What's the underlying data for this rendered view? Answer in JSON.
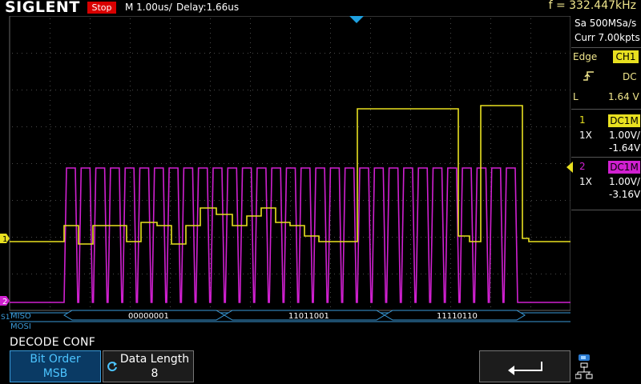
{
  "header": {
    "logo": "SIGLENT",
    "run_status": "Stop",
    "timebase": "M 1.00us/",
    "delay": "Delay:1.66us",
    "frequency": "f = 332.447kHz"
  },
  "acquisition": {
    "sample_rate": "Sa 500MSa/s",
    "memory": "Curr 7.00kpts"
  },
  "trigger": {
    "mode": "Edge",
    "source": "CH1",
    "coupling": "DC",
    "slope_icon": "rising-edge-icon",
    "level_label": "L",
    "level": "1.64 V"
  },
  "channels": [
    {
      "number": "1",
      "coupling": "DC1M",
      "probe": "1X",
      "scale": "1.00V/",
      "offset": "-1.64V",
      "color": "#e8e020"
    },
    {
      "number": "2",
      "coupling": "DC1M",
      "probe": "1X",
      "scale": "1.00V/",
      "offset": "-3.16V",
      "color": "#d020d0"
    }
  ],
  "trace_markers": {
    "ch1": "1",
    "ch2": "2"
  },
  "decode": {
    "bus_label": "S1",
    "lines": [
      "MISO",
      "MOSI"
    ],
    "frames": [
      "00000001",
      "11011001",
      "11110110"
    ],
    "color": "#3a9ad8"
  },
  "menu": {
    "title": "DECODE CONF",
    "bit_order_label": "Bit Order",
    "bit_order_value": "MSB",
    "data_length_label": "Data Length",
    "data_length_value": "8",
    "back_icon": "back-arrow-icon"
  },
  "colors": {
    "ch1": "#e8e020",
    "ch2": "#d020d0",
    "trigger_marker": "#1ea0e0",
    "grid": "#4a4a4a"
  },
  "waveform": {
    "ch1_levels": [
      0,
      0,
      0,
      0,
      1,
      1,
      2,
      2,
      2,
      2,
      3,
      3,
      3,
      3,
      3,
      3,
      3,
      3,
      3,
      3,
      4,
      4,
      4,
      4,
      4,
      4,
      4,
      4,
      4,
      4,
      4
    ]
  }
}
